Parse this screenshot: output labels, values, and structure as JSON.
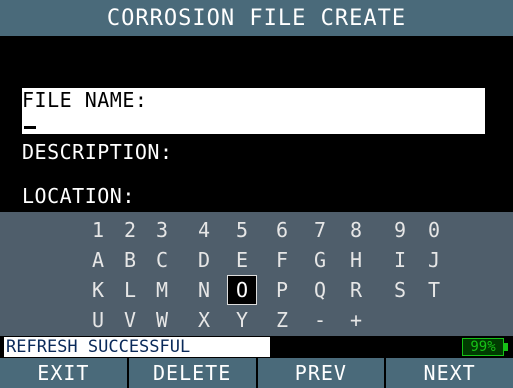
{
  "title": "CORROSION FILE CREATE",
  "form": {
    "file_name_label": "FILE NAME:",
    "file_name_value": "",
    "description_label": "DESCRIPTION:",
    "location_label": "LOCATION:"
  },
  "keyboard": {
    "rows": [
      [
        "1",
        "2",
        "3",
        "4",
        "5",
        "6",
        "7",
        "8",
        "9",
        "0"
      ],
      [
        "A",
        "B",
        "C",
        "D",
        "E",
        "F",
        "G",
        "H",
        "I",
        "J"
      ],
      [
        "K",
        "L",
        "M",
        "N",
        "O",
        "P",
        "Q",
        "R",
        "S",
        "T"
      ],
      [
        "U",
        "V",
        "W",
        "X",
        "Y",
        "Z",
        "-",
        "+"
      ]
    ],
    "selected": "O"
  },
  "status": {
    "message": "REFRESH SUCCESSFUL",
    "battery": "99%"
  },
  "softkeys": {
    "exit": "EXIT",
    "delete": "DELETE",
    "prev": "PREV",
    "next": "NEXT"
  },
  "colors": {
    "title_bg": "#4a6a7a",
    "keyboard_bg": "#4f5e6b",
    "battery": "#16c116",
    "status_text": "#0a2a5a"
  }
}
